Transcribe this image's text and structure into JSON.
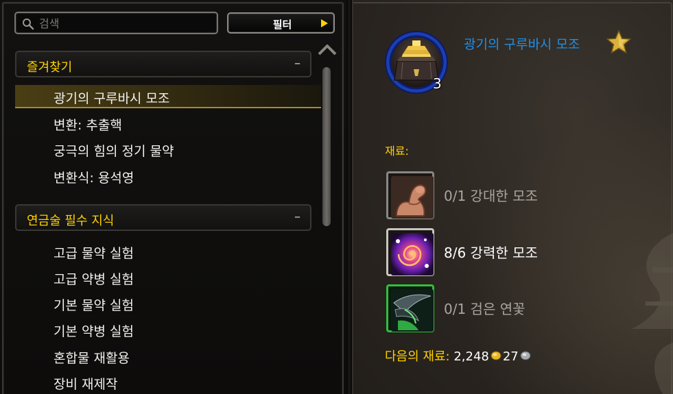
{
  "search": {
    "placeholder": "검색",
    "value": ""
  },
  "filter_button": {
    "label": "필터"
  },
  "categories": [
    {
      "label": "즐겨찾기",
      "collapse_symbol": "–",
      "items": [
        {
          "label": "광기의 구루바시 모조",
          "selected": true
        },
        {
          "label": "변환: 추출핵"
        },
        {
          "label": "궁극의 힘의 정기 물약"
        },
        {
          "label": "변환식: 용석영"
        }
      ]
    },
    {
      "label": "연금술 필수 지식",
      "collapse_symbol": "–",
      "items": [
        {
          "label": "고급 물약 실험"
        },
        {
          "label": "고급 약병 실험"
        },
        {
          "label": "기본 물약 실험"
        },
        {
          "label": "기본 약병 실험"
        },
        {
          "label": "혼합물 재활용"
        },
        {
          "label": "장비 재제작"
        }
      ]
    }
  ],
  "scrollbar": {
    "position_fraction": 0.0
  },
  "recipe": {
    "title": "광기의 구루바시 모조",
    "count": "3",
    "icon": "gurubashi-mojo-icon",
    "favorited": true,
    "reagents_label": "재료:",
    "reagents": [
      {
        "text": "0/1 강대한 모조",
        "icon": "mighty-mojo-flexed-arm-icon",
        "has_enough": false,
        "border": "#8a8884"
      },
      {
        "text": "8/6 강력한 모조",
        "icon": "powerful-mojo-swirl-icon",
        "has_enough": true,
        "border": "#c9c6c0"
      },
      {
        "text": "0/1 검은 연꽃",
        "icon": "black-lotus-blade-icon",
        "has_enough": false,
        "border": "#2ec13b"
      }
    ],
    "next_cost": {
      "label": "다음의 재료:",
      "gold": "2,248",
      "silver": "27"
    }
  },
  "colors": {
    "gold_text": "#ffd100",
    "title_blue": "#1f8fe6",
    "dim_text": "#a9a6a1"
  }
}
